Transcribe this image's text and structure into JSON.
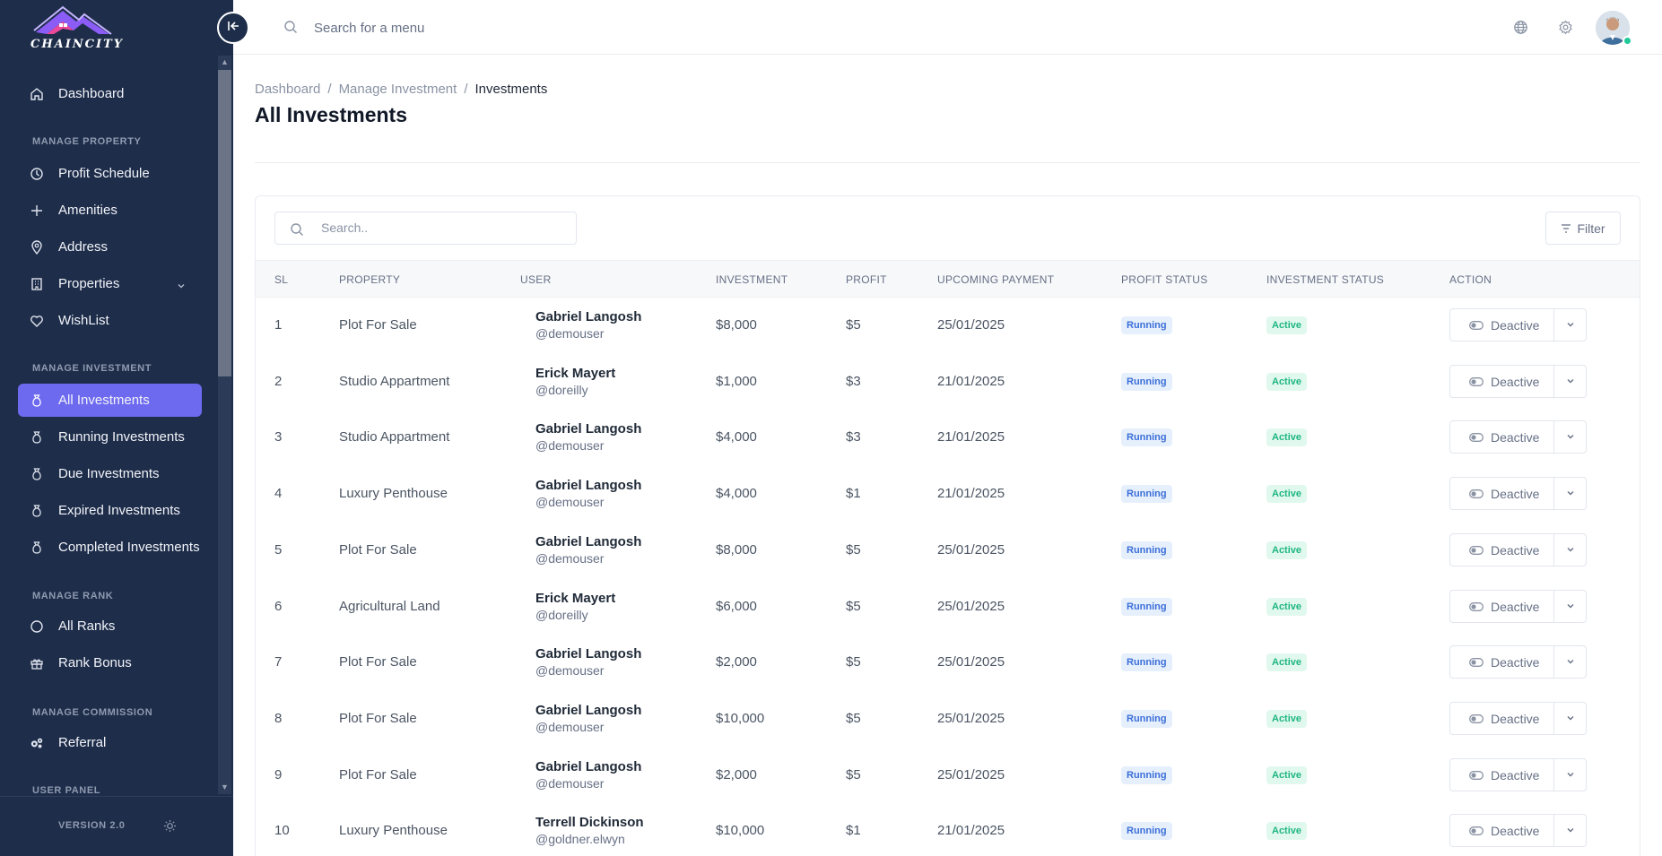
{
  "brand": {
    "name": "CHAINCITY"
  },
  "sidebar": {
    "dashboard": "Dashboard",
    "sections": {
      "property": "MANAGE PROPERTY",
      "investment": "MANAGE INVESTMENT",
      "rank": "MANAGE RANK",
      "commission": "MANAGE COMMISSION",
      "user_panel": "USER PANEL"
    },
    "property_items": [
      "Profit Schedule",
      "Amenities",
      "Address",
      "Properties",
      "WishList"
    ],
    "investment_items": [
      "All Investments",
      "Running Investments",
      "Due Investments",
      "Expired Investments",
      "Completed Investments"
    ],
    "rank_items": [
      "All Ranks",
      "Rank Bonus"
    ],
    "commission_items": [
      "Referral"
    ],
    "version": "VERSION 2.0",
    "active_color": "#6e6af0",
    "background_color": "#1e2d4a"
  },
  "topbar": {
    "search_placeholder": "Search for a menu"
  },
  "breadcrumb": [
    "Dashboard",
    "Manage Investment",
    "Investments"
  ],
  "page_title": "All Investments",
  "table_controls": {
    "search_placeholder": "Search..",
    "filter_label": "Filter"
  },
  "table": {
    "headers": [
      "SL",
      "PROPERTY",
      "USER",
      "INVESTMENT",
      "PROFIT",
      "UPCOMING PAYMENT",
      "PROFIT STATUS",
      "INVESTMENT STATUS",
      "ACTION"
    ],
    "action_label": "Deactive",
    "rows": [
      {
        "sl": "1",
        "property": "Plot For Sale",
        "user_name": "Gabriel Langosh",
        "user_handle": "@demouser",
        "investment": "$8,000",
        "profit": "$5",
        "payment": "25/01/2025",
        "profit_status": "Running",
        "investment_status": "Active"
      },
      {
        "sl": "2",
        "property": "Studio Appartment",
        "user_name": "Erick Mayert",
        "user_handle": "@doreilly",
        "investment": "$1,000",
        "profit": "$3",
        "payment": "21/01/2025",
        "profit_status": "Running",
        "investment_status": "Active"
      },
      {
        "sl": "3",
        "property": "Studio Appartment",
        "user_name": "Gabriel Langosh",
        "user_handle": "@demouser",
        "investment": "$4,000",
        "profit": "$3",
        "payment": "21/01/2025",
        "profit_status": "Running",
        "investment_status": "Active"
      },
      {
        "sl": "4",
        "property": "Luxury Penthouse",
        "user_name": "Gabriel Langosh",
        "user_handle": "@demouser",
        "investment": "$4,000",
        "profit": "$1",
        "payment": "21/01/2025",
        "profit_status": "Running",
        "investment_status": "Active"
      },
      {
        "sl": "5",
        "property": "Plot For Sale",
        "user_name": "Gabriel Langosh",
        "user_handle": "@demouser",
        "investment": "$8,000",
        "profit": "$5",
        "payment": "25/01/2025",
        "profit_status": "Running",
        "investment_status": "Active"
      },
      {
        "sl": "6",
        "property": "Agricultural Land",
        "user_name": "Erick Mayert",
        "user_handle": "@doreilly",
        "investment": "$6,000",
        "profit": "$5",
        "payment": "25/01/2025",
        "profit_status": "Running",
        "investment_status": "Active"
      },
      {
        "sl": "7",
        "property": "Plot For Sale",
        "user_name": "Gabriel Langosh",
        "user_handle": "@demouser",
        "investment": "$2,000",
        "profit": "$5",
        "payment": "25/01/2025",
        "profit_status": "Running",
        "investment_status": "Active"
      },
      {
        "sl": "8",
        "property": "Plot For Sale",
        "user_name": "Gabriel Langosh",
        "user_handle": "@demouser",
        "investment": "$10,000",
        "profit": "$5",
        "payment": "25/01/2025",
        "profit_status": "Running",
        "investment_status": "Active"
      },
      {
        "sl": "9",
        "property": "Plot For Sale",
        "user_name": "Gabriel Langosh",
        "user_handle": "@demouser",
        "investment": "$2,000",
        "profit": "$5",
        "payment": "25/01/2025",
        "profit_status": "Running",
        "investment_status": "Active"
      },
      {
        "sl": "10",
        "property": "Luxury Penthouse",
        "user_name": "Terrell Dickinson",
        "user_handle": "@goldner.elwyn",
        "investment": "$10,000",
        "profit": "$1",
        "payment": "21/01/2025",
        "profit_status": "Running",
        "investment_status": "Active"
      }
    ]
  }
}
